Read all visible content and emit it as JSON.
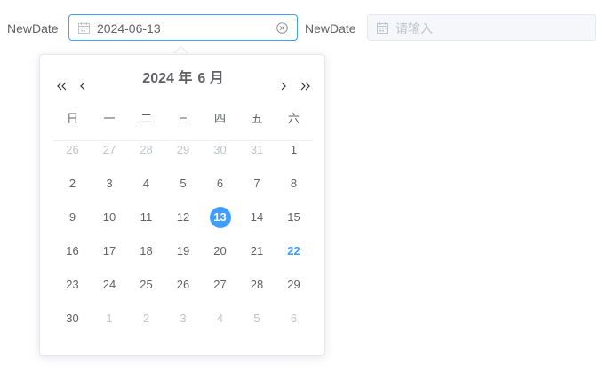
{
  "field1": {
    "label": "NewDate",
    "value": "2024-06-13"
  },
  "field2": {
    "label": "NewDate",
    "placeholder": "请输入"
  },
  "calendar": {
    "year": "2024 年",
    "month": "6 月",
    "weekdays": [
      "日",
      "一",
      "二",
      "三",
      "四",
      "五",
      "六"
    ],
    "weeks": [
      [
        "26",
        "27",
        "28",
        "29",
        "30",
        "31",
        "1"
      ],
      [
        "2",
        "3",
        "4",
        "5",
        "6",
        "7",
        "8"
      ],
      [
        "9",
        "10",
        "11",
        "12",
        "13",
        "14",
        "15"
      ],
      [
        "16",
        "17",
        "18",
        "19",
        "20",
        "21",
        "22"
      ],
      [
        "23",
        "24",
        "25",
        "26",
        "27",
        "28",
        "29"
      ],
      [
        "30",
        "1",
        "2",
        "3",
        "4",
        "5",
        "6"
      ]
    ],
    "selected": "13",
    "today": "22"
  },
  "colors": {
    "accent": "#409eff",
    "text": "#606266",
    "muted": "#c0c4cc"
  },
  "icons": {
    "calendar": "calendar-icon",
    "clear": "circle-close-icon",
    "prev_year": "double-arrow-left-icon",
    "prev_month": "arrow-left-icon",
    "next_month": "arrow-right-icon",
    "next_year": "double-arrow-right-icon"
  }
}
